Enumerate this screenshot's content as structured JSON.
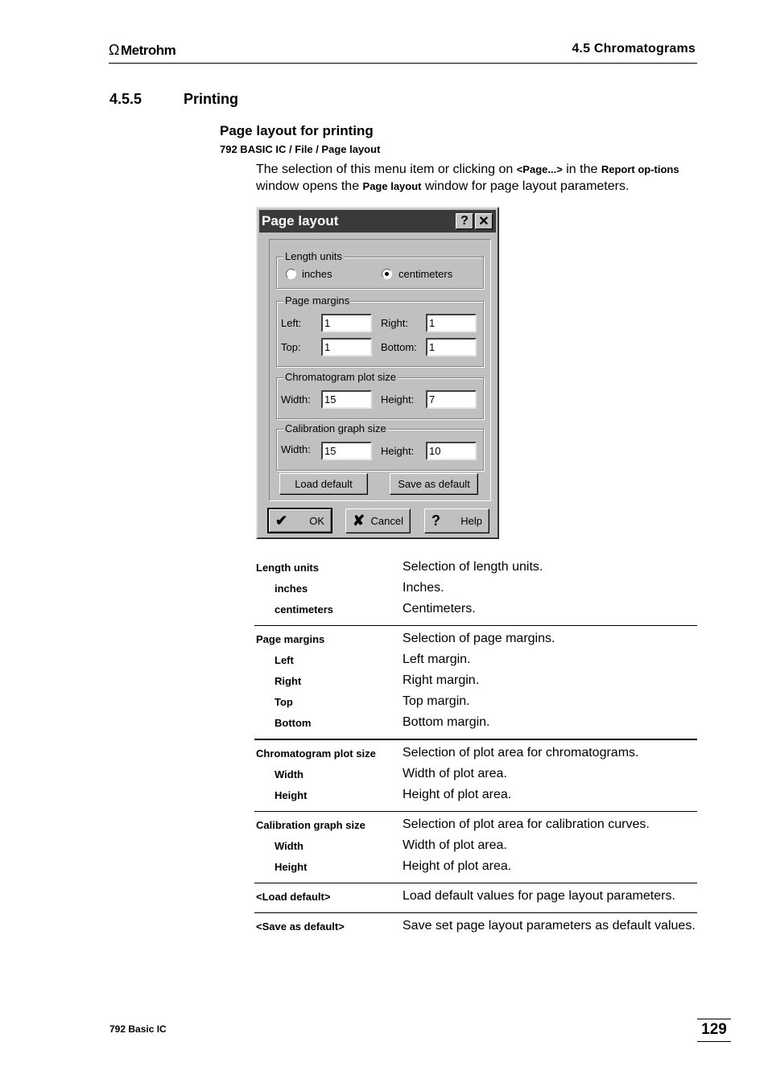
{
  "header": {
    "logo_text": "Metrohm",
    "logo_icon": "omega-icon",
    "section_title": "4.5  Chromatograms"
  },
  "section": {
    "number": "4.5.5",
    "title": "Printing"
  },
  "subsection": {
    "title": "Page layout for printing",
    "menu_path": "792 BASIC IC / File / Page layout"
  },
  "intro": {
    "part1": "The selection of this menu item or clicking on ",
    "button_ref": "<Page...>",
    "part2": " in the ",
    "window_ref": "Report op-tions",
    "part3": " window opens the ",
    "dialog_ref": "Page layout",
    "part4": " window for page layout parameters."
  },
  "dialog": {
    "title": "Page layout",
    "help_button": "?",
    "close_button": "✕",
    "length_units": {
      "legend": "Length units",
      "options": [
        {
          "label": "inches",
          "selected": false
        },
        {
          "label": "centimeters",
          "selected": true
        }
      ]
    },
    "page_margins": {
      "legend": "Page margins",
      "left_label": "Left:",
      "left_value": "1",
      "right_label": "Right:",
      "right_value": "1",
      "top_label": "Top:",
      "top_value": "1",
      "bottom_label": "Bottom:",
      "bottom_value": "1"
    },
    "chromatogram_plot_size": {
      "legend": "Chromatogram plot size",
      "width_label": "Width:",
      "width_value": "15",
      "height_label": "Height:",
      "height_value": "7"
    },
    "calibration_graph_size": {
      "legend": "Calibration graph size",
      "width_label": "Width:",
      "width_value": "15",
      "height_label": "Height:",
      "height_value": "10"
    },
    "load_default_label": "Load default",
    "save_default_label": "Save as default",
    "ok_label": "OK",
    "cancel_label": "Cancel",
    "help_label": "Help"
  },
  "descriptions": [
    {
      "rows": [
        {
          "term": "Length units",
          "def": "Selection of length units.",
          "sub": false
        },
        {
          "term": "inches",
          "def": "Inches.",
          "sub": true
        },
        {
          "term": "centimeters",
          "def": "Centimeters.",
          "sub": true
        }
      ]
    },
    {
      "rows": [
        {
          "term": "Page margins",
          "def": "Selection of page margins.",
          "sub": false
        },
        {
          "term": "Left",
          "def": "Left margin.",
          "sub": true
        },
        {
          "term": "Right",
          "def": "Right margin.",
          "sub": true
        },
        {
          "term": "Top",
          "def": "Top margin.",
          "sub": true
        },
        {
          "term": "Bottom",
          "def": "Bottom margin.",
          "sub": true
        }
      ]
    },
    {
      "rows": [
        {
          "term": "Chromatogram plot size",
          "def": "Selection of plot area for chromatograms.",
          "sub": false
        },
        {
          "term": "Width",
          "def": "Width of plot area.",
          "sub": true
        },
        {
          "term": "Height",
          "def": "Height of plot area.",
          "sub": true
        }
      ]
    },
    {
      "rows": [
        {
          "term": "Calibration graph size",
          "def": "Selection of plot area for calibration curves.",
          "sub": false
        },
        {
          "term": "Width",
          "def": "Width of plot area.",
          "sub": true
        },
        {
          "term": "Height",
          "def": "Height of plot area.",
          "sub": true
        }
      ]
    },
    {
      "rows": [
        {
          "term": "<Load default>",
          "def": "Load default values for page layout parameters.",
          "sub": false
        }
      ]
    },
    {
      "rows": [
        {
          "term": "<Save as default>",
          "def": "Save set page layout parameters as default values.",
          "sub": false
        }
      ]
    }
  ],
  "footer": {
    "product": "792 Basic IC",
    "page_number": "129"
  }
}
